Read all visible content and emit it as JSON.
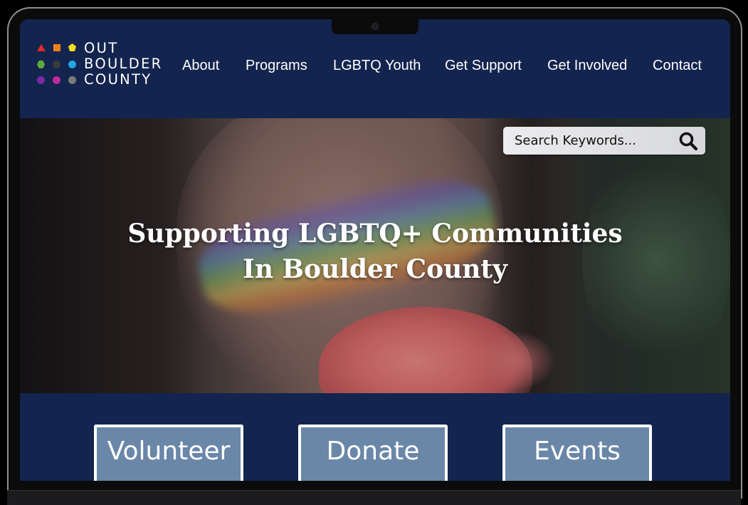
{
  "logo": {
    "lines": [
      "OUT",
      "BOULDER",
      "COUNTY"
    ],
    "colors": [
      "#e52a2a",
      "#f2811d",
      "#f7dd1e",
      "#5daa3c",
      "#3a3a3a",
      "#1ea7e2",
      "#7a2aa0",
      "#c02b9a",
      "#7a7a7a"
    ]
  },
  "nav": {
    "items": [
      "About",
      "Programs",
      "LGBTQ Youth",
      "Get Support",
      "Get Involved",
      "Contact"
    ]
  },
  "search": {
    "placeholder": "Search Keywords...",
    "icon": "search-icon"
  },
  "hero": {
    "headline_line1": "Supporting LGBTQ+ Communities",
    "headline_line2": "In Boulder County"
  },
  "cta": {
    "volunteer": "Volunteer",
    "donate": "Donate",
    "events": "Events"
  },
  "colors": {
    "header_bg": "#13244e",
    "cta_bg": "#6a87a8",
    "text": "#ffffff"
  }
}
